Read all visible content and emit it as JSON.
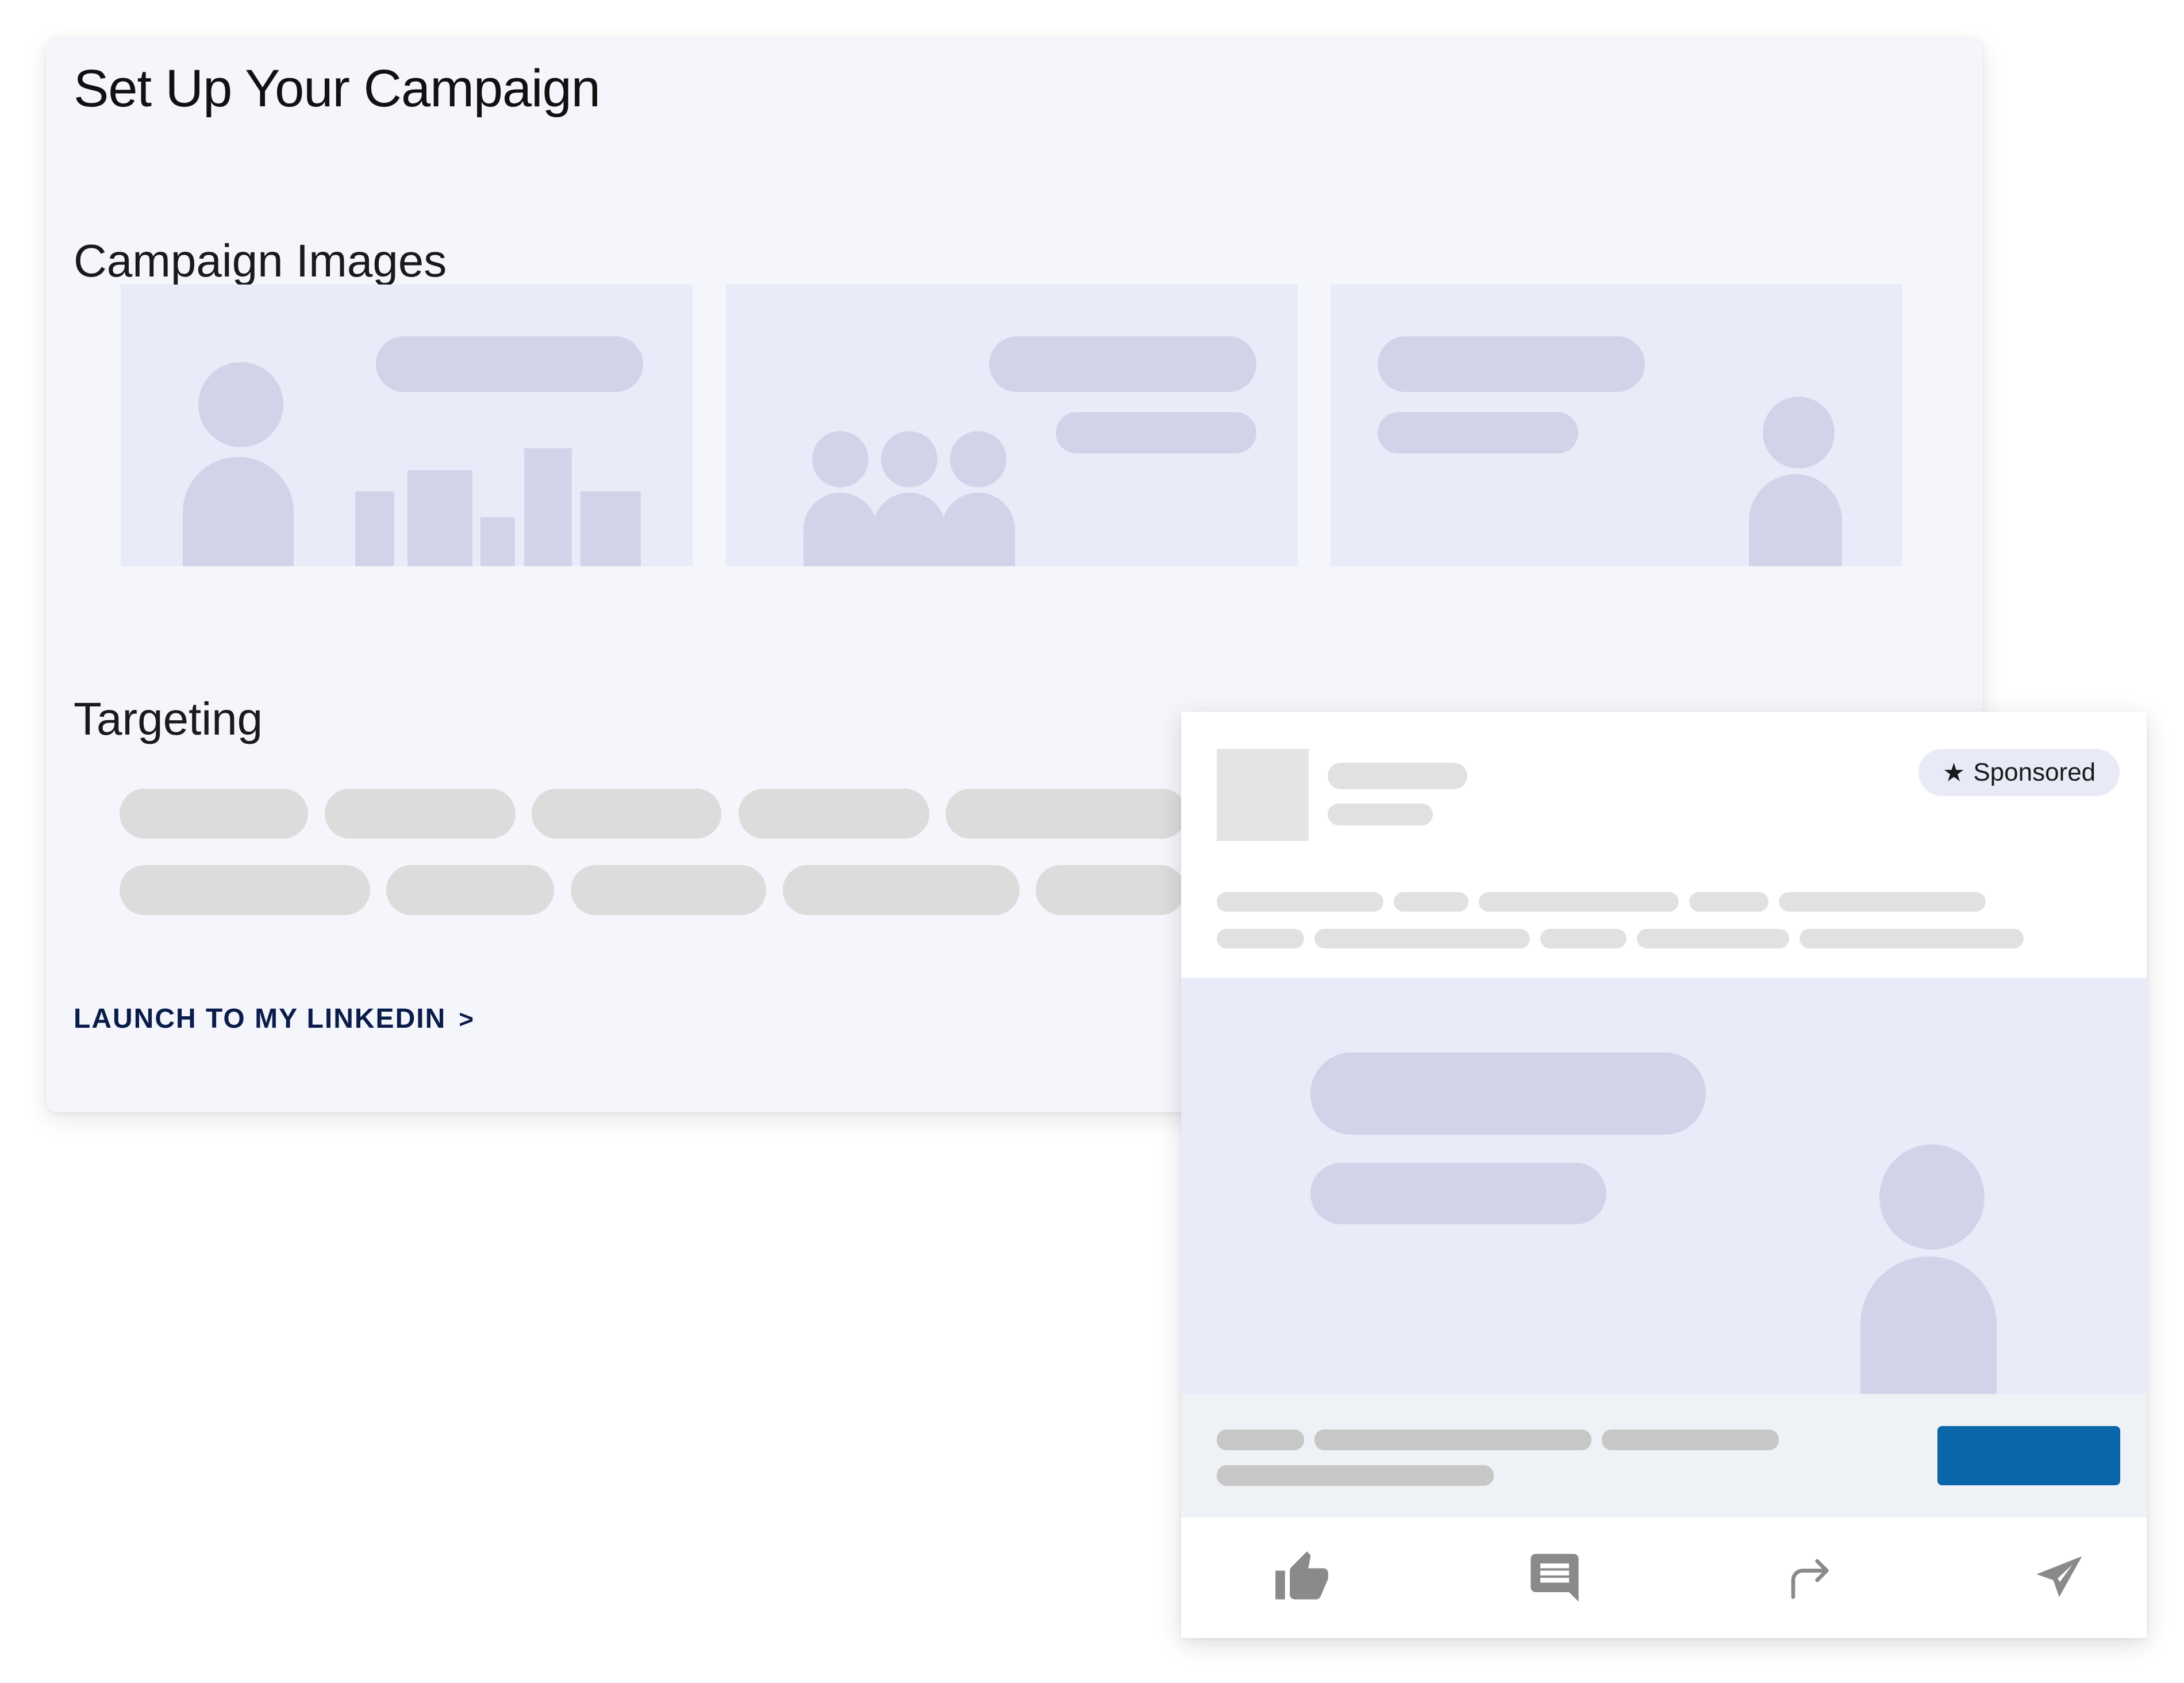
{
  "campaign": {
    "title": "Set Up Your Campaign",
    "images_heading": "Campaign Images",
    "targeting_heading": "Targeting",
    "launch_label": "LAUNCH TO MY LINKEDIN",
    "launch_chevron": ">"
  },
  "post": {
    "badge_star": "★",
    "badge_label": "Sponsored",
    "cta_color": "#0a66a8",
    "action_icons": [
      "like-icon",
      "comment-icon",
      "share-icon",
      "send-icon"
    ]
  },
  "colors": {
    "card_bg": "#f5f6fb",
    "placeholder_bg": "#e9ebf9",
    "placeholder_shape": "#d1d4e9",
    "chip": "#dcdcdc",
    "icon": "#8a8a8a"
  }
}
